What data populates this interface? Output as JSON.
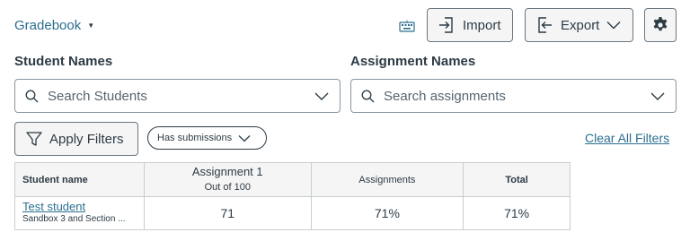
{
  "header": {
    "gradebook_label": "Gradebook",
    "import_label": "Import",
    "export_label": "Export"
  },
  "icons": {
    "keyboard": "keyboard-icon",
    "import": "import-icon",
    "export": "export-icon",
    "settings": "gear-icon",
    "search": "search-icon",
    "chevron": "chevron-down-icon",
    "filter": "filter-icon"
  },
  "filters": {
    "student_names_label": "Student Names",
    "student_search_placeholder": "Search Students",
    "assignment_names_label": "Assignment Names",
    "assignment_search_placeholder": "Search assignments",
    "apply_filters_label": "Apply Filters",
    "active_filter_pill": "Has submissions",
    "clear_all_label": "Clear All Filters"
  },
  "grid": {
    "columns": {
      "student": "Student name",
      "assignment_title": "Assignment 1",
      "assignment_points": "Out of 100",
      "assignments_group": "Assignments",
      "total": "Total"
    },
    "rows": [
      {
        "student_name": "Test student",
        "section": "Sandbox 3 and Section ...",
        "assignment_1": "71",
        "assignments_pct": "71%",
        "total_pct": "71%"
      }
    ]
  },
  "colors": {
    "link": "#2b6e90",
    "text": "#2d3b45",
    "border": "#c7cdd1",
    "header_bg": "#f5f5f5"
  }
}
